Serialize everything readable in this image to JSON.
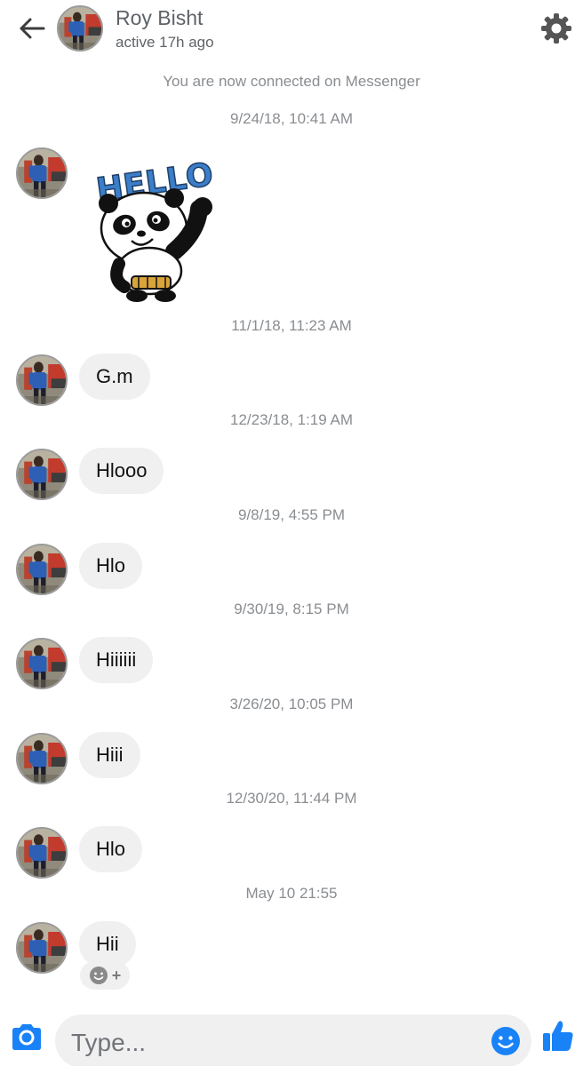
{
  "header": {
    "contact_name": "Roy Bisht",
    "active_status": "active 17h ago",
    "back_icon": "arrow-left-icon",
    "settings_icon": "gear-icon"
  },
  "conversation": {
    "system_note": "You are now connected on Messenger",
    "items": [
      {
        "timestamp": "9/24/18, 10:41 AM",
        "type": "sticker",
        "sticker": "hello-panda-sticker",
        "sticker_text": "HELLO"
      },
      {
        "timestamp": "11/1/18, 11:23 AM",
        "type": "text",
        "text": "G.m"
      },
      {
        "timestamp": "12/23/18, 1:19 AM",
        "type": "text",
        "text": "Hlooo"
      },
      {
        "timestamp": "9/8/19, 4:55 PM",
        "type": "text",
        "text": "Hlo"
      },
      {
        "timestamp": "9/30/19, 8:15 PM",
        "type": "text",
        "text": "Hiiiiii"
      },
      {
        "timestamp": "3/26/20, 10:05 PM",
        "type": "text",
        "text": "Hiii"
      },
      {
        "timestamp": "12/30/20, 11:44 PM",
        "type": "text",
        "text": "Hlo"
      },
      {
        "timestamp": "May 10 21:55",
        "type": "text",
        "text": "Hii"
      }
    ],
    "reaction_button_icon": "add-reaction-icon"
  },
  "composer": {
    "placeholder": "Type...",
    "camera_icon": "camera-icon",
    "emoji_icon": "smiley-icon",
    "like_icon": "thumbs-up-icon"
  },
  "colors": {
    "accent": "#1a82f7",
    "bubble_bg": "#f0f0f0",
    "timestamp_text": "#8a8d91",
    "header_text": "#5f6368"
  }
}
